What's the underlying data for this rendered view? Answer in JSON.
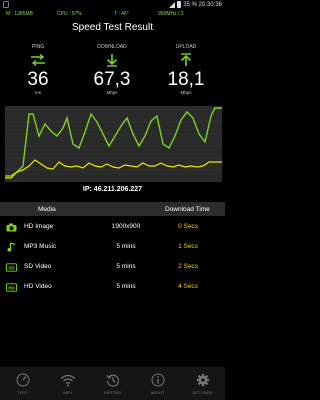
{
  "status_bar": {
    "text": "35 % 20:30:36"
  },
  "info_bar": {
    "memory": "M : 1285MB",
    "cpu": "CPU : 57%",
    "temp": "T :    46°",
    "freq": "960MHz / 3"
  },
  "title": "Speed Test Result",
  "metrics": {
    "ping": {
      "label": "PING",
      "value": "36",
      "unit": "ms",
      "icon": "ping-icon"
    },
    "download": {
      "label": "DOWNLOAD",
      "value": "67,3",
      "unit": "Mbps",
      "icon": "download-arrow-icon"
    },
    "upload": {
      "label": "UPLOAD",
      "value": "18,1",
      "unit": "Mbps",
      "icon": "upload-arrow-icon"
    }
  },
  "colors": {
    "accent_green": "#7ed321",
    "time_yellow": "#f5d000"
  },
  "ip": "IP: 46.211.206.227",
  "table": {
    "headers": [
      "Media",
      "Download Time"
    ],
    "rows": [
      {
        "name": "HD Image",
        "size": "1900x900",
        "time": "0 Secs",
        "icon": "camera-icon"
      },
      {
        "name": "MP3 Music",
        "size": "5 mins",
        "time": "1 Secs",
        "icon": "music-note-icon"
      },
      {
        "name": "SD Video",
        "size": "5 mins",
        "time": "2 Secs",
        "icon": "sd-video-icon"
      },
      {
        "name": "HD Video",
        "size": "5 mins",
        "time": "4 Secs",
        "icon": "hd-video-icon"
      }
    ]
  },
  "nav": [
    {
      "label": "TEST",
      "icon": "speedometer-icon"
    },
    {
      "label": "WIFI",
      "icon": "wifi-icon"
    },
    {
      "label": "HISTORY",
      "icon": "history-icon"
    },
    {
      "label": "ABOUT",
      "icon": "info-icon"
    },
    {
      "label": "SETTINGS",
      "icon": "gear-icon"
    }
  ]
}
